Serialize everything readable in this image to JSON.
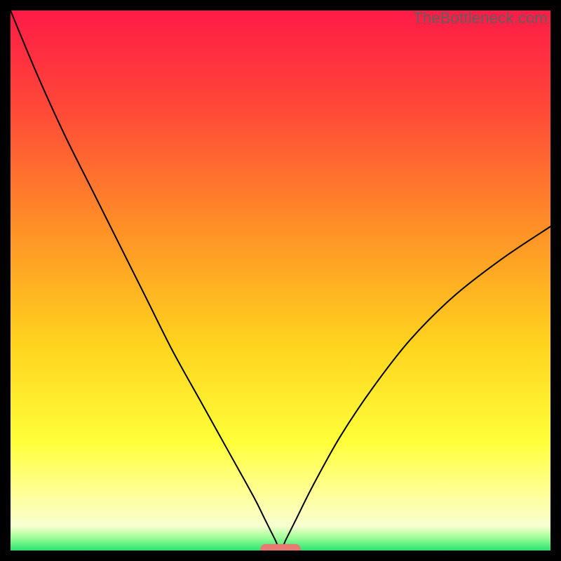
{
  "watermark": "TheBottleneck.com",
  "chart_data": {
    "type": "line",
    "title": "",
    "xlabel": "",
    "ylabel": "",
    "xlim": [
      0,
      100
    ],
    "ylim": [
      0,
      100
    ],
    "axes_visible": false,
    "grid": false,
    "background_gradient": {
      "direction": "top-to-bottom",
      "stops": [
        {
          "pos": 0.0,
          "color": "#ff1b47"
        },
        {
          "pos": 0.18,
          "color": "#ff4838"
        },
        {
          "pos": 0.4,
          "color": "#ff8f27"
        },
        {
          "pos": 0.62,
          "color": "#ffd41e"
        },
        {
          "pos": 0.8,
          "color": "#ffff3a"
        },
        {
          "pos": 0.9,
          "color": "#ffff9e"
        },
        {
          "pos": 0.955,
          "color": "#f7ffd0"
        },
        {
          "pos": 0.975,
          "color": "#a3ff9a"
        },
        {
          "pos": 1.0,
          "color": "#28e56f"
        }
      ]
    },
    "series": [
      {
        "name": "bottleneck-curve",
        "color": "#000000",
        "stroke_width": 2,
        "x": [
          0,
          5,
          10,
          15,
          20,
          25,
          30,
          35,
          40,
          45,
          47,
          49,
          50,
          51,
          53,
          56,
          61,
          67,
          74,
          82,
          91,
          100
        ],
        "y": [
          100,
          88,
          77,
          67,
          57,
          47,
          37,
          28,
          19,
          10,
          6,
          2,
          0,
          2,
          6,
          12,
          21,
          30,
          39,
          47,
          54,
          60
        ]
      }
    ],
    "marker": {
      "name": "valley-marker",
      "shape": "rounded-rect",
      "color": "#e77a73",
      "center_x": 50,
      "center_y": 0.2,
      "width": 7.5,
      "height": 2.0
    }
  }
}
